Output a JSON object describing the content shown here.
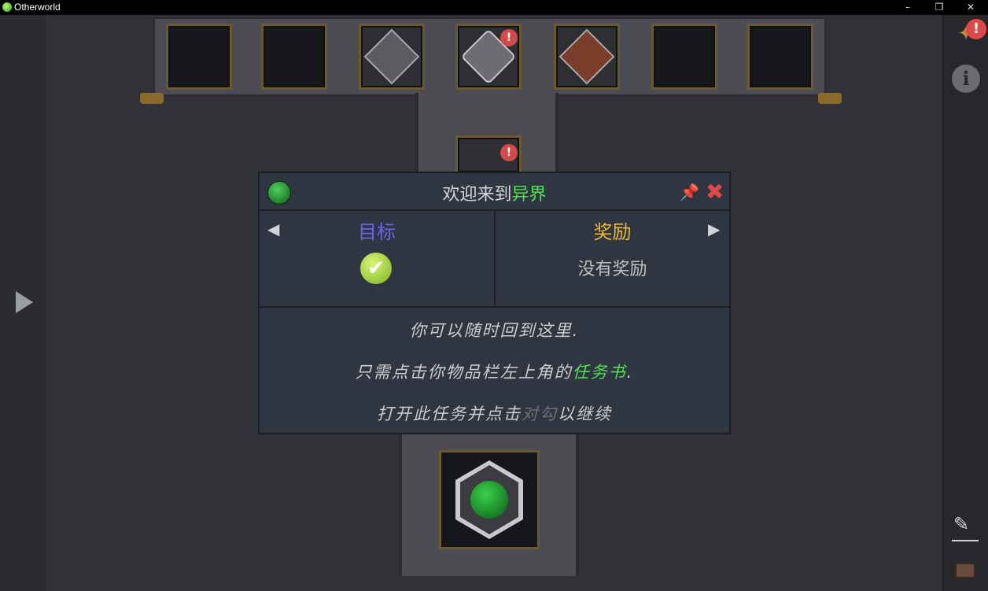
{
  "window": {
    "title": "Otherworld",
    "controls": {
      "minimize": "–",
      "restore": "❐",
      "close": "✕"
    }
  },
  "top_slots": [
    {
      "icon": "empty-slot"
    },
    {
      "icon": "empty-slot"
    },
    {
      "icon": "diamond-sword-icon"
    },
    {
      "icon": "crafting-grid-icon",
      "alert": "!"
    },
    {
      "icon": "brick-chest-icon"
    },
    {
      "icon": "empty-slot"
    },
    {
      "icon": "empty-slot"
    }
  ],
  "sub_slot": {
    "icon": "orb-icon",
    "alert": "!"
  },
  "dialog": {
    "title_prefix": "欢迎来到",
    "title_highlight": "异界",
    "pin_glyph": "📌",
    "close_glyph": "✖",
    "goal_label": "目标",
    "reward_label": "奖励",
    "no_reward": "没有奖励",
    "line1": "你可以随时回到这里.",
    "line2_prefix": "只需点击你物品栏左上角的",
    "line2_highlight": "任务书",
    "line2_suffix": ".",
    "line3_prefix": "打开此任务并点击",
    "line3_highlight": "对勾",
    "line3_suffix": "以继续",
    "left_arrow": "◀",
    "right_arrow": "▶",
    "check_glyph": "✔"
  },
  "colors": {
    "goal": "#6e63e6",
    "reward": "#e8b93a",
    "highlight": "#55e055",
    "close": "#e04848"
  },
  "sidebar": {
    "alert": "!",
    "info": "i",
    "edit_glyph": "✎"
  }
}
